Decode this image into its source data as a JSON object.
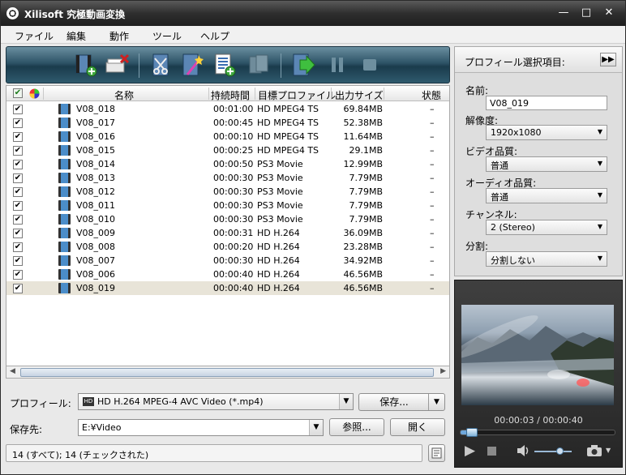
{
  "window": {
    "title": "Xilisoft 究極動画変換"
  },
  "menu": [
    "ファイル",
    "編集",
    "動作",
    "ツール",
    "ヘルプ"
  ],
  "columns": {
    "name": "名称",
    "duration": "持続時間",
    "profile": "目標プロファイル",
    "size": "出力サイズ",
    "status": "状態"
  },
  "rows": [
    {
      "name": "V08_018",
      "duration": "00:01:00",
      "profile": "HD MPEG4 TS",
      "size": "69.84MB",
      "status": "–",
      "checked": true
    },
    {
      "name": "V08_017",
      "duration": "00:00:45",
      "profile": "HD MPEG4 TS",
      "size": "52.38MB",
      "status": "–",
      "checked": true
    },
    {
      "name": "V08_016",
      "duration": "00:00:10",
      "profile": "HD MPEG4 TS",
      "size": "11.64MB",
      "status": "–",
      "checked": true
    },
    {
      "name": "V08_015",
      "duration": "00:00:25",
      "profile": "HD MPEG4 TS",
      "size": "29.1MB",
      "status": "–",
      "checked": true
    },
    {
      "name": "V08_014",
      "duration": "00:00:50",
      "profile": "PS3 Movie",
      "size": "12.99MB",
      "status": "–",
      "checked": true
    },
    {
      "name": "V08_013",
      "duration": "00:00:30",
      "profile": "PS3 Movie",
      "size": "7.79MB",
      "status": "–",
      "checked": true
    },
    {
      "name": "V08_012",
      "duration": "00:00:30",
      "profile": "PS3 Movie",
      "size": "7.79MB",
      "status": "–",
      "checked": true
    },
    {
      "name": "V08_011",
      "duration": "00:00:30",
      "profile": "PS3 Movie",
      "size": "7.79MB",
      "status": "–",
      "checked": true
    },
    {
      "name": "V08_010",
      "duration": "00:00:30",
      "profile": "PS3 Movie",
      "size": "7.79MB",
      "status": "–",
      "checked": true
    },
    {
      "name": "V08_009",
      "duration": "00:00:31",
      "profile": "HD H.264",
      "size": "36.09MB",
      "status": "–",
      "checked": true
    },
    {
      "name": "V08_008",
      "duration": "00:00:20",
      "profile": "HD H.264",
      "size": "23.28MB",
      "status": "–",
      "checked": true
    },
    {
      "name": "V08_007",
      "duration": "00:00:30",
      "profile": "HD H.264",
      "size": "34.92MB",
      "status": "–",
      "checked": true
    },
    {
      "name": "V08_006",
      "duration": "00:00:40",
      "profile": "HD H.264",
      "size": "46.56MB",
      "status": "–",
      "checked": true
    },
    {
      "name": "V08_019",
      "duration": "00:00:40",
      "profile": "HD H.264",
      "size": "46.56MB",
      "status": "–",
      "checked": true,
      "selected": true
    }
  ],
  "bottom": {
    "profile_label": "プロフィール:",
    "profile_value": "HD H.264 MPEG-4 AVC Video (*.mp4)",
    "save_label": "保存...",
    "dest_label": "保存先:",
    "dest_value": "E:¥Video",
    "browse_label": "参照...",
    "open_label": "開く",
    "status_text": "14 (すべて); 14 (チェックされた)"
  },
  "profile_panel": {
    "header": "プロフィール選択項目:",
    "name_label": "名前:",
    "name_value": "V08_019",
    "resolution_label": "解像度:",
    "resolution_value": "1920x1080",
    "video_quality_label": "ビデオ品質:",
    "video_quality_value": "普通",
    "audio_quality_label": "オーディオ品質:",
    "audio_quality_value": "普通",
    "channel_label": "チャンネル:",
    "channel_value": "2 (Stereo)",
    "split_label": "分割:",
    "split_value": "分割しない"
  },
  "player": {
    "time": "00:00:03 / 00:00:40",
    "progress": 0.075,
    "volume": 0.7
  }
}
